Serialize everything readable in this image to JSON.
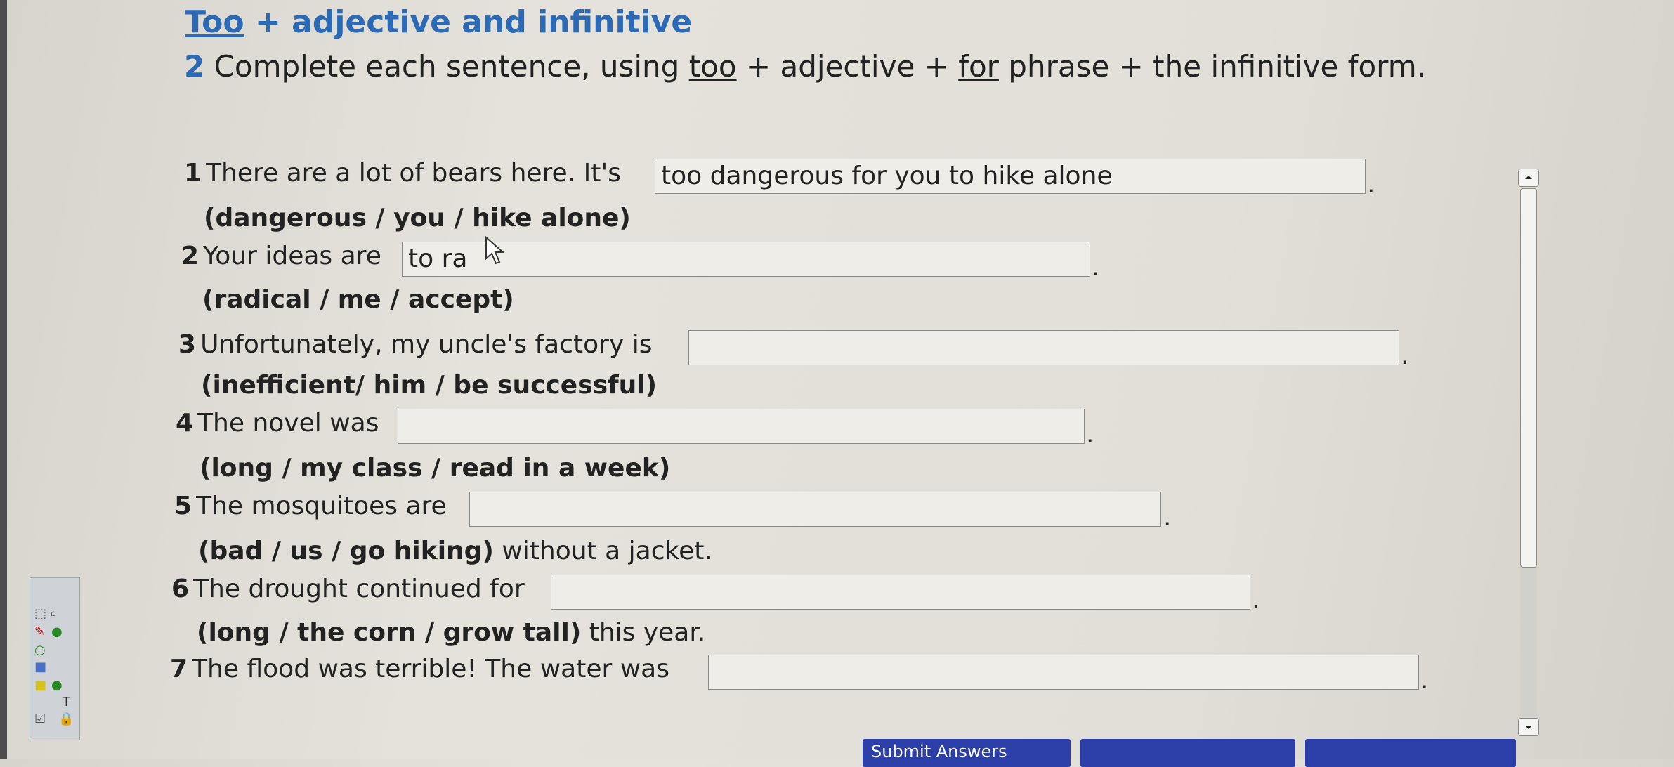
{
  "header": {
    "title_prefix": "Too",
    "title_rest": " + adjective and infinitive"
  },
  "instructions": {
    "number": "2",
    "text_a": " Complete each sentence, using ",
    "too": "too",
    "text_b": " + adjective + ",
    "for": "for",
    "text_c": " phrase + the infinitive form."
  },
  "questions": [
    {
      "num": "1",
      "stem": "There are a lot of bears here. It's",
      "value": "too dangerous for you to hike alone",
      "hint": "(dangerous / you / hike alone)",
      "hint_after": ""
    },
    {
      "num": "2",
      "stem": "Your ideas are",
      "value": "to ra",
      "hint": "(radical / me / accept)",
      "hint_after": ""
    },
    {
      "num": "3",
      "stem": "Unfortunately, my uncle's factory is",
      "value": "",
      "hint": "(inefficient/ him / be successful)",
      "hint_after": ""
    },
    {
      "num": "4",
      "stem": "The novel was",
      "value": "",
      "hint": "(long / my class / read in a week)",
      "hint_after": ""
    },
    {
      "num": "5",
      "stem": "The mosquitoes are",
      "value": "",
      "hint": "(bad / us / go hiking)",
      "hint_after": " without a jacket."
    },
    {
      "num": "6",
      "stem": "The drought continued for",
      "value": "",
      "hint": "(long / the corn / grow tall)",
      "hint_after": " this year."
    },
    {
      "num": "7",
      "stem": "The flood was terrible! The water was",
      "value": "",
      "hint": "",
      "hint_after": ""
    }
  ],
  "period": ".",
  "footer": {
    "submit_label": "Submit Answers"
  },
  "icons": {
    "scroll_up": "scroll-up-arrow-icon",
    "scroll_down": "scroll-down-arrow-icon",
    "cursor": "mouse-pointer-icon"
  }
}
